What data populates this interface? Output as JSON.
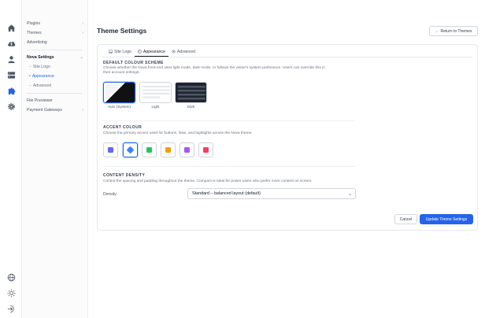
{
  "rail": {
    "icons": [
      "home-icon",
      "cloud-upload-icon",
      "user-icon",
      "database-icon",
      "puzzle-icon",
      "gear-icon"
    ],
    "bottom_icons": [
      "globe-icon",
      "sun-icon",
      "logout-icon"
    ]
  },
  "sidebar": {
    "items": [
      {
        "label": "Plugins",
        "chev": "›"
      },
      {
        "label": "Themes",
        "chev": "›"
      },
      {
        "label": "Advertising",
        "chev": ""
      }
    ],
    "nova": {
      "label": "Nova Settings",
      "chev": "⌄"
    },
    "nova_subs": [
      {
        "label": "Site Logo",
        "dash": "–"
      },
      {
        "label": "Appearance",
        "dash": "•"
      },
      {
        "label": "Advanced",
        "dash": "–"
      }
    ],
    "bottom_items": [
      {
        "label": "File Previewer",
        "chev": ""
      },
      {
        "label": "Payment Gateways",
        "chev": "›"
      }
    ]
  },
  "header": {
    "title": "Theme Settings",
    "return_label": "Return to Themes",
    "return_arrow": "←"
  },
  "tabs": [
    {
      "label": "Site Logo",
      "icon": "image-icon"
    },
    {
      "label": "Appearance",
      "icon": "palette-icon"
    },
    {
      "label": "Advanced",
      "icon": "gear-icon"
    }
  ],
  "colour_scheme": {
    "title": "DEFAULT COLOUR SCHEME",
    "desc_line1": "Choose whether the Nova front-end uses light mode, dark mode, or follows the visitor's system preference. Users can override this in",
    "desc_line2": "their account settings.",
    "options": [
      {
        "label": "Auto (System)",
        "selected": true
      },
      {
        "label": "Light",
        "selected": false
      },
      {
        "label": "Dark",
        "selected": false
      }
    ]
  },
  "accent": {
    "title": "ACCENT COLOUR",
    "desc": "Choose the primary accent used for buttons, links, and highlights across the Nova theme.",
    "swatches": [
      {
        "color": "#6366f1",
        "selected": false
      },
      {
        "color": "#3b82f6",
        "selected": true
      },
      {
        "color": "#22c55e",
        "selected": false
      },
      {
        "color": "#f59e0b",
        "selected": false
      },
      {
        "color": "#a855f7",
        "selected": false
      },
      {
        "color": "#f43f5e",
        "selected": false
      }
    ]
  },
  "density": {
    "title": "CONTENT DENSITY",
    "desc": "Control the spacing and padding throughout the theme. Compact is ideal for power users who prefer more content on screen.",
    "label": "Density:",
    "value": "Standard – balanced layout (default)",
    "caret": "⌄"
  },
  "actions": {
    "cancel_label": "Cancel",
    "update_label": "Update Theme Settings"
  },
  "colors": {
    "accent": "#2563eb"
  }
}
